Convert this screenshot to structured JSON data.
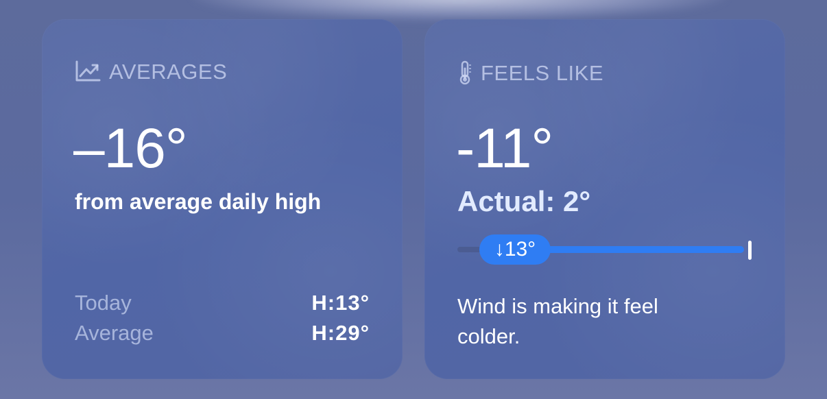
{
  "averages": {
    "title": "AVERAGES",
    "icon": "chart-line-icon",
    "difference": "–16°",
    "caption": "from average daily high",
    "rows": [
      {
        "label": "Today",
        "value": "H:13°"
      },
      {
        "label": "Average",
        "value": "H:29°"
      }
    ]
  },
  "feels_like": {
    "title": "FEELS LIKE",
    "icon": "thermometer-icon",
    "temperature": "-11°",
    "actual": "Actual: 2°",
    "slider_label": "↓13°",
    "description": "Wind is making it feel colder."
  },
  "colors": {
    "accent_blue": "#2f7df3",
    "card_background": "#5268a6"
  }
}
